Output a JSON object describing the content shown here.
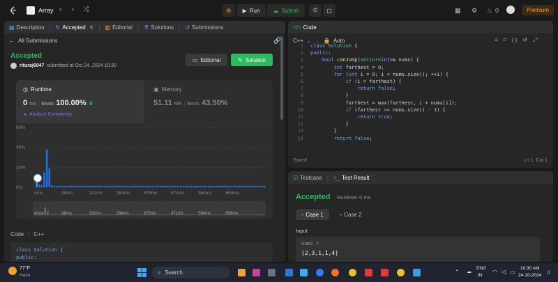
{
  "app": {
    "problem_title": "Array"
  },
  "header": {
    "run_label": "Run",
    "submit_label": "Submit",
    "streak_count": "0",
    "premium_label": "Premium"
  },
  "left_panel": {
    "tabs": [
      "Description",
      "Accepted",
      "Editorial",
      "Solutions",
      "Submissions"
    ],
    "back_label": "All Submissions",
    "status": "Accepted",
    "user": "rituraj6047",
    "submitted_text": "submitted at Oct 24, 2024 10:30",
    "editorial_button": "Editorial",
    "solution_button": "Solution",
    "runtime": {
      "label": "Runtime",
      "value": "0",
      "unit": "ms",
      "beats_label": "Beats",
      "beats_value": "100.00%"
    },
    "memory": {
      "label": "Memory",
      "value": "51.11",
      "unit": "MB",
      "beats_label": "Beats",
      "beats_value": "43.50%"
    },
    "analyze_label": "Analyze Complexity",
    "code_label": "Code",
    "code_lang": "C++",
    "code_lines": [
      "class Solution {",
      "public:"
    ]
  },
  "chart_data": {
    "type": "bar",
    "ylim": [
      0,
      60
    ],
    "y_ticks": [
      "60%",
      "40%",
      "20%",
      "0%"
    ],
    "x_ticks": [
      "4ms",
      "98ms",
      "191ms",
      "284ms",
      "378ms",
      "471ms",
      "564ms",
      "658ms"
    ],
    "mini_ticks": [
      "4ms",
      "98ms",
      "191ms",
      "284ms",
      "378ms",
      "471ms",
      "564ms",
      "658ms"
    ],
    "values": [
      5,
      3,
      2,
      15,
      38,
      19,
      2,
      1.5,
      1.5,
      1.5,
      1.5,
      1.5,
      1.5,
      1.5,
      1.5,
      1.5,
      1.5,
      1.5,
      1.5,
      1.5,
      1.5,
      1.5,
      1.5,
      1.5,
      1.5,
      1.5,
      1.5,
      1.5,
      1.5,
      1.5,
      1.5,
      1.5,
      1.5,
      1.5,
      1.5,
      1.5,
      1.5,
      1.5,
      1.5,
      1.5,
      1.5,
      1.5,
      1.5,
      1.5,
      1.5,
      1.5,
      1.5,
      1.5,
      1.5,
      1.5,
      1.5,
      1.5,
      1.5,
      1.5,
      1.5,
      1.5,
      1.5,
      1.5,
      1.5,
      1.5,
      1.5,
      1.5,
      1.5,
      1.5,
      1.5,
      1.5,
      1.5,
      1.5,
      1.5,
      1.5,
      1.5,
      1.5,
      1.5,
      1.5,
      1.5,
      1.5,
      1.5,
      1.5,
      1.5,
      1.5,
      1.5,
      1.5,
      1.5,
      1.5,
      1.5,
      1.5,
      1.5,
      1.5,
      1.5,
      1.5,
      1.5
    ],
    "bar_color": "#1e6fd9",
    "highlight_color": "#3b8eea"
  },
  "code_panel": {
    "title": "Code",
    "language": "C++",
    "mode": "Auto",
    "saved_label": "Saved",
    "cursor_pos": "Ln 1, Col 1",
    "lines": [
      {
        "n": "1",
        "t": "class Solution {"
      },
      {
        "n": "2",
        "t": "public:"
      },
      {
        "n": "3",
        "t": "    bool canJump(vector<int>& nums) {"
      },
      {
        "n": "4",
        "t": "        int farthest = 0;"
      },
      {
        "n": "5",
        "t": "        for (int i = 0; i < nums.size(); ++i) {"
      },
      {
        "n": "6",
        "t": "            if (i > farthest) {"
      },
      {
        "n": "7",
        "t": "                return false;"
      },
      {
        "n": "8",
        "t": "            }"
      },
      {
        "n": "9",
        "t": "            farthest = max(farthest, i + nums[i]);"
      },
      {
        "n": "10",
        "t": "            if (farthest >= nums.size() - 1) {"
      },
      {
        "n": "11",
        "t": "                return true;"
      },
      {
        "n": "12",
        "t": "            }"
      },
      {
        "n": "13",
        "t": "        }"
      },
      {
        "n": "14",
        "t": "        return false;"
      }
    ]
  },
  "result_panel": {
    "tabs": [
      "Testcase",
      "Test Result"
    ],
    "status": "Accepted",
    "runtime": "Runtime: 0 ms",
    "cases": [
      "Case 1",
      "Case 2"
    ],
    "input_label": "Input",
    "var_name": "nums =",
    "var_value": "[2,3,1,1,4]"
  },
  "taskbar": {
    "weather_temp": "77°F",
    "weather_desc": "Haze",
    "search_placeholder": "Search",
    "lang": "ENG",
    "region": "IN",
    "time": "10:30 AM",
    "date": "24-10-2024"
  },
  "colors": {
    "accent_green": "#2cbb5d",
    "accepted_text": "#2cbb5d",
    "premium": "#ffa116"
  }
}
